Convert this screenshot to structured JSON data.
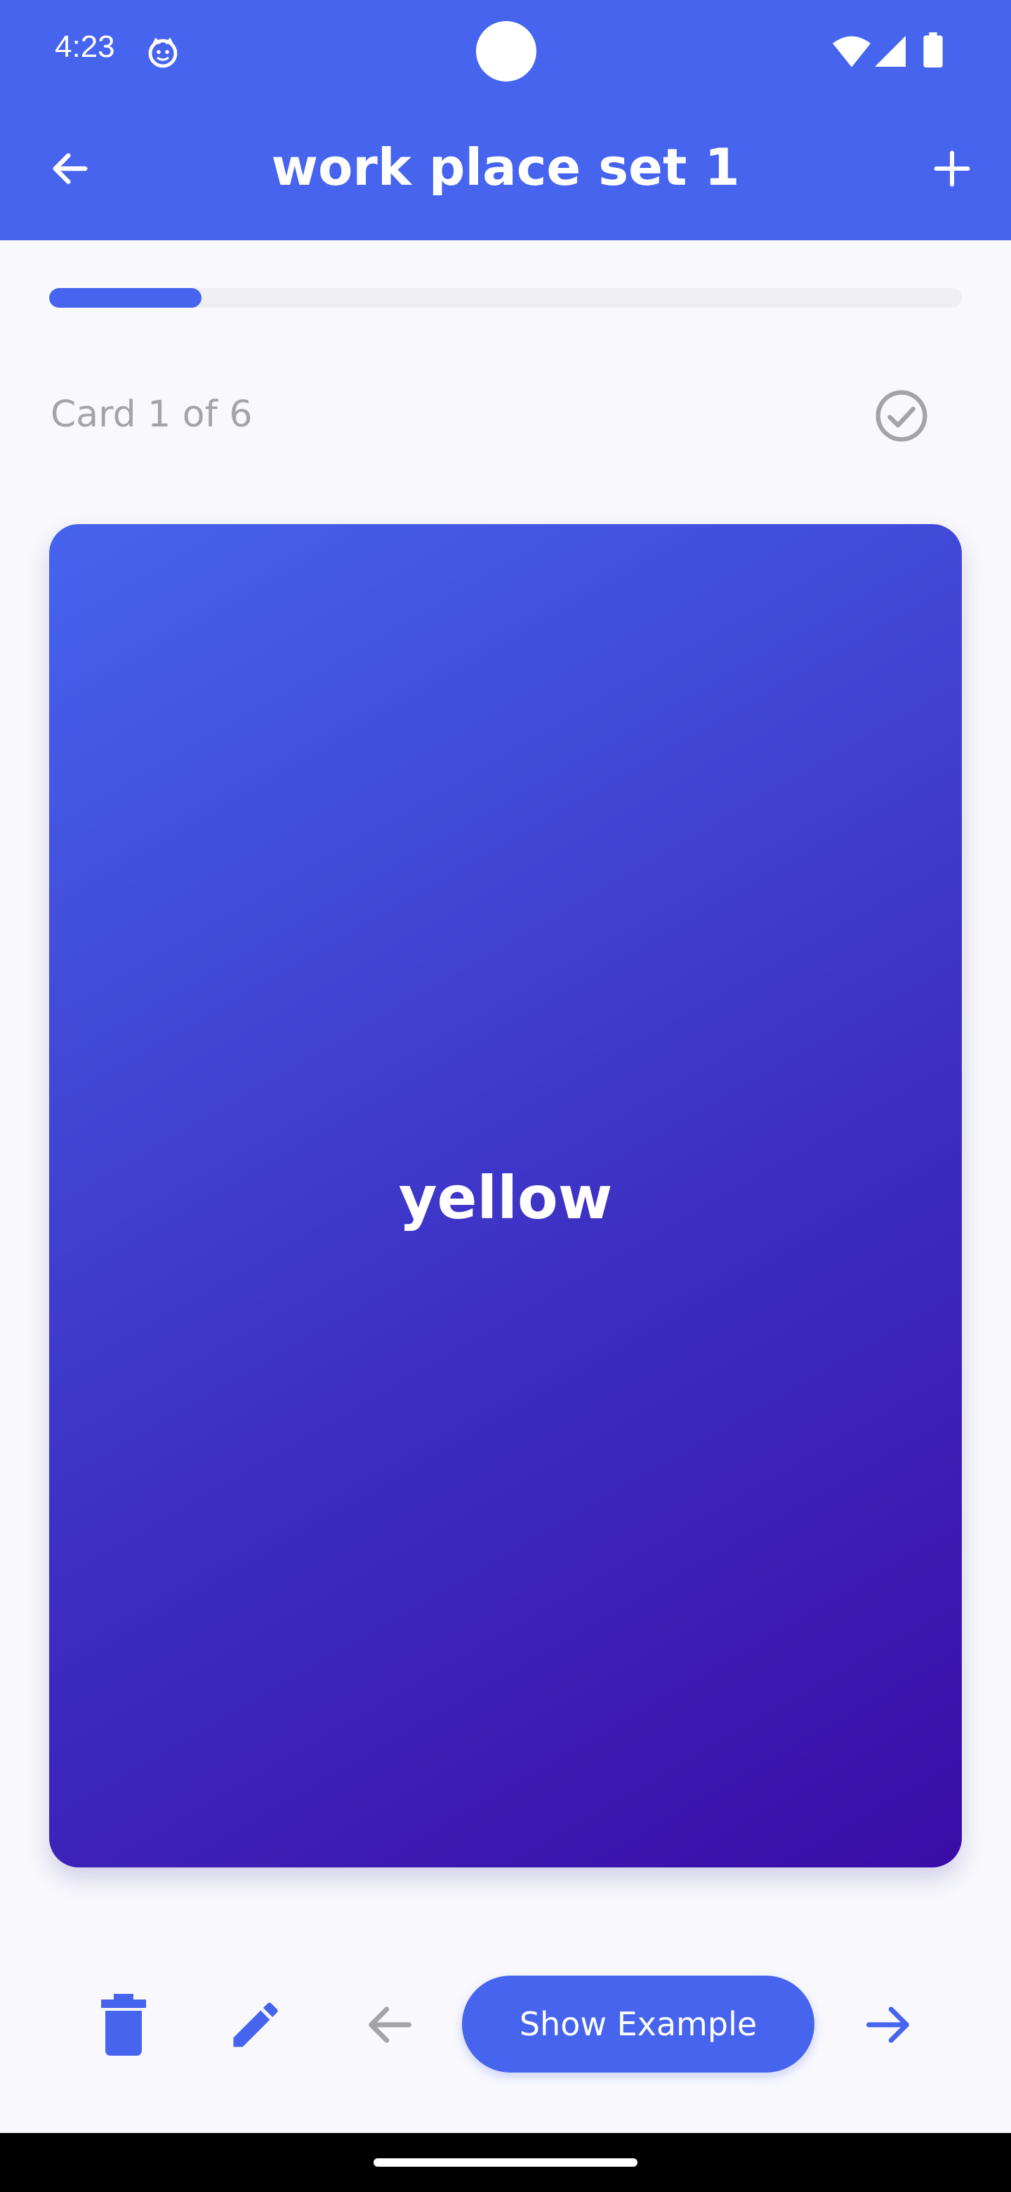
{
  "status_bar": {
    "time": "4:23",
    "app_icon": "cat-face-icon",
    "wifi_icon": "wifi-icon",
    "signal_icon": "signal-icon",
    "battery_icon": "battery-icon"
  },
  "app_bar": {
    "title": "work place set 1",
    "back_icon": "arrow-left-icon",
    "add_icon": "plus-icon",
    "background_color": "#4664ee"
  },
  "progress": {
    "current": 1,
    "total": 6,
    "fraction": 0.1667,
    "fill_color": "#4664ee"
  },
  "card_counter": "Card 1 of 6",
  "check_icon": "check-circle-icon",
  "card": {
    "word": "yellow",
    "gradient_start": "#4664ee",
    "gradient_end": "#3a0ca8"
  },
  "bottom_bar": {
    "delete_icon": "trash-icon",
    "edit_icon": "pencil-icon",
    "prev_icon": "arrow-left-icon",
    "show_example_label": "Show Example",
    "next_icon": "arrow-right-icon"
  }
}
